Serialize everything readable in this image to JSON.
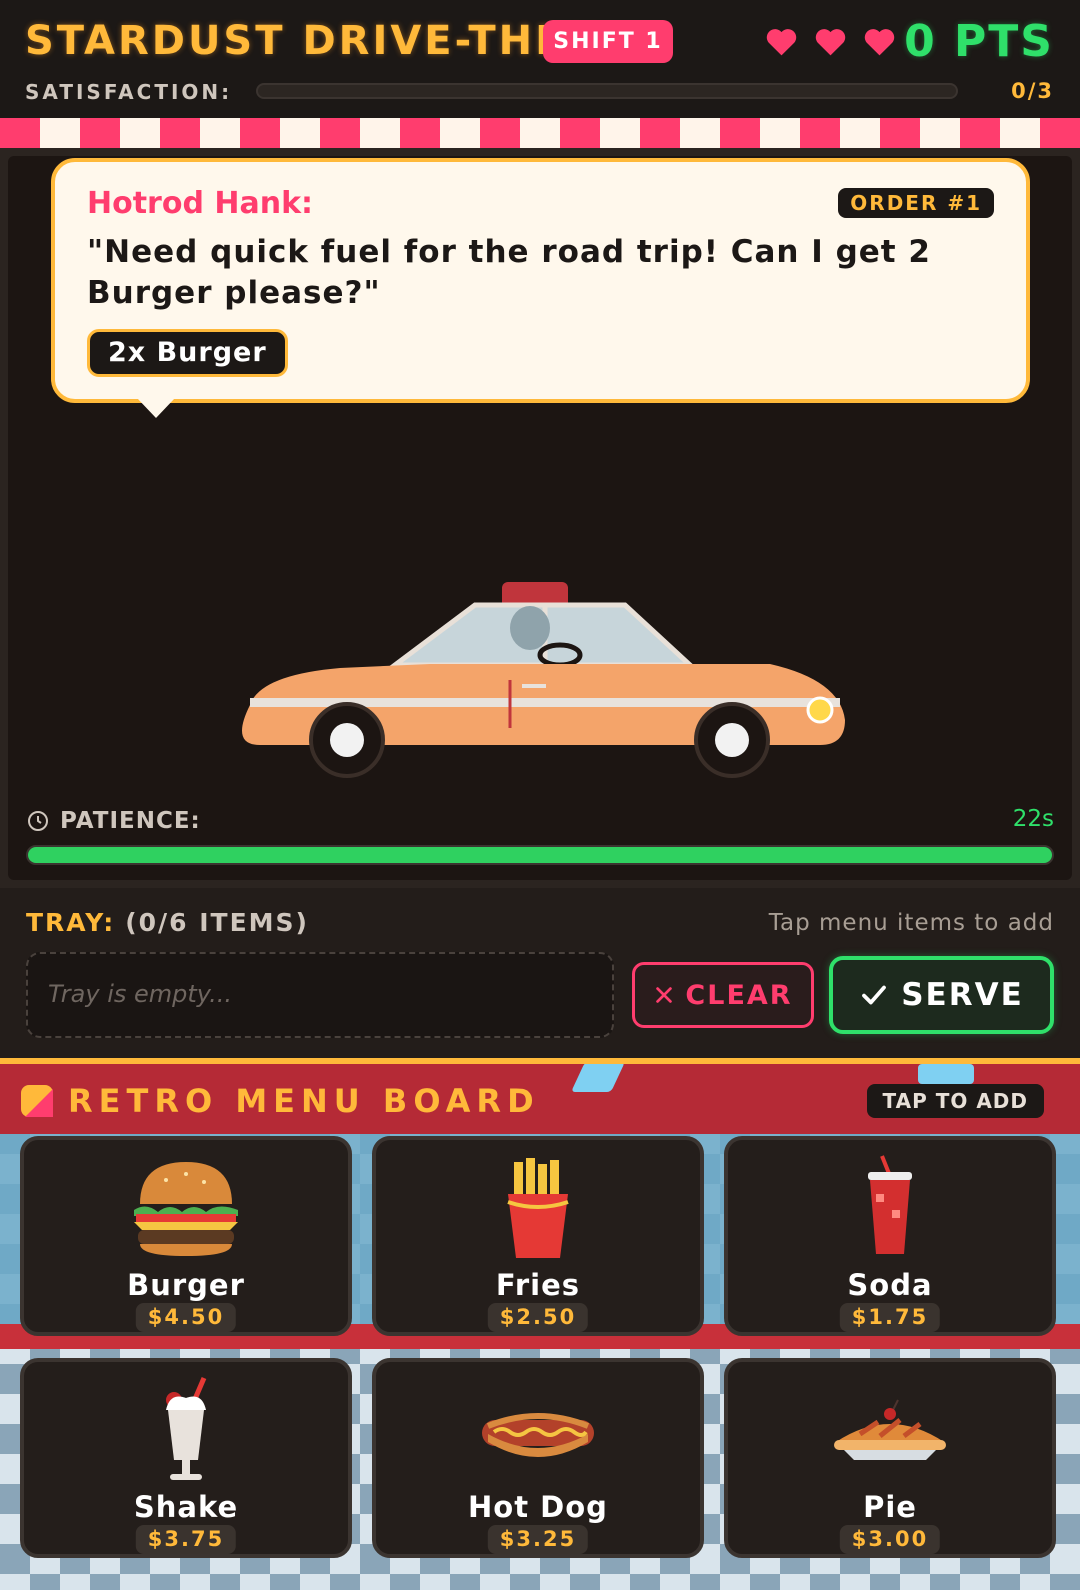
{
  "header": {
    "title": "STARDUST DRIVE-THRU",
    "shift": "SHIFT 1",
    "lives": 3,
    "points": "0 PTS",
    "satisfaction_label": "SATISFACTION:",
    "satisfaction_count": "0/3",
    "satisfaction_progress": 0
  },
  "order": {
    "speaker": "Hotrod Hank:",
    "order_number": "ORDER #1",
    "dialogue": "\"Need quick fuel for the road trip! Can I get 2 Burger please?\"",
    "request_chip": "2x Burger"
  },
  "patience": {
    "label": "PATIENCE:",
    "time": "22s",
    "progress": 1.0
  },
  "tray": {
    "label": "TRAY:",
    "count": "(0/6 ITEMS)",
    "hint": "Tap menu items to add",
    "empty_text": "Tray is empty...",
    "clear_label": "CLEAR",
    "serve_label": "SERVE"
  },
  "menu": {
    "title": "RETRO MENU BOARD",
    "tap_hint": "TAP TO ADD",
    "items": [
      {
        "name": "Burger",
        "price": "$4.50",
        "icon": "burger-icon"
      },
      {
        "name": "Fries",
        "price": "$2.50",
        "icon": "fries-icon"
      },
      {
        "name": "Soda",
        "price": "$1.75",
        "icon": "soda-icon"
      },
      {
        "name": "Shake",
        "price": "$3.75",
        "icon": "shake-icon"
      },
      {
        "name": "Hot Dog",
        "price": "$3.25",
        "icon": "hotdog-icon"
      },
      {
        "name": "Pie",
        "price": "$3.00",
        "icon": "pie-icon"
      }
    ]
  },
  "colors": {
    "accent": "#ffb93a",
    "pink": "#ff3d6e",
    "green": "#2fe06a",
    "car_body": "#f4a46a"
  }
}
